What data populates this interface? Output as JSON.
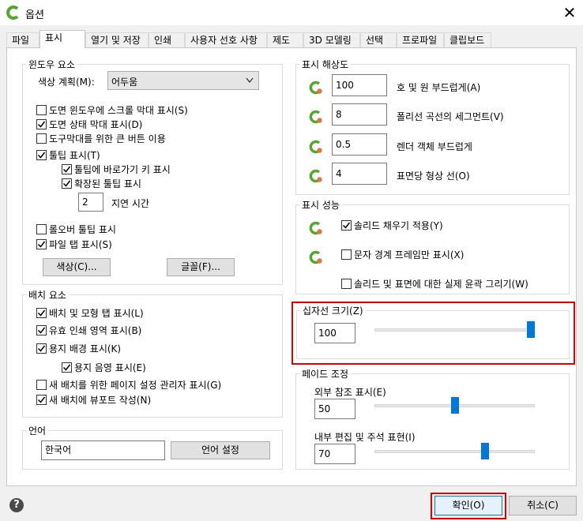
{
  "window": {
    "title": "옵션",
    "close_glyph": "✕"
  },
  "tabs": [
    {
      "label": "파일"
    },
    {
      "label": "표시"
    },
    {
      "label": "열기 및 저장"
    },
    {
      "label": "인쇄"
    },
    {
      "label": "사용자 선호 사항"
    },
    {
      "label": "제도"
    },
    {
      "label": "3D 모델링"
    },
    {
      "label": "선택"
    },
    {
      "label": "프로파일"
    },
    {
      "label": "클립보드"
    }
  ],
  "active_tab": "표시",
  "window_elements": {
    "title": "윈도우 요소",
    "color_scheme_label": "색상 계획(M):",
    "color_scheme_value": "어두움",
    "checkboxes": [
      {
        "label": "도면 윈도우에 스크롤 막대 표시(S)",
        "checked": false
      },
      {
        "label": "도면 상태 막대 표시(D)",
        "checked": true
      },
      {
        "label": "도구막대를 위한 큰 버튼 이용",
        "checked": false
      },
      {
        "label": "툴팁 표시(T)",
        "checked": true
      },
      {
        "label": "툴팁에 바로가기 키 표시",
        "checked": true
      },
      {
        "label": "확장된 툴팁 표시",
        "checked": true
      },
      {
        "label": "롤오버 툴팁 표시",
        "checked": false
      },
      {
        "label": "파일 탭 표시(S)",
        "checked": true
      }
    ],
    "delay_value": "2",
    "delay_label": "지연 시간",
    "colors_button": "색상(C)...",
    "fonts_button": "글꼴(F)..."
  },
  "layout_elements": {
    "title": "배치 요소",
    "checkboxes": [
      {
        "label": "배치 및 모형 탭 표시(L)",
        "checked": true
      },
      {
        "label": "유효 인쇄 영역 표시(B)",
        "checked": true
      },
      {
        "label": "용지 배경 표시(K)",
        "checked": true
      },
      {
        "label": "용지 음영 표시(E)",
        "checked": true
      },
      {
        "label": "새 배치를 위한 페이지 설정 관리자 표시(G)",
        "checked": false
      },
      {
        "label": "새 배치에 뷰포트 작성(N)",
        "checked": true
      }
    ]
  },
  "language": {
    "title": "언어",
    "value": "한국어",
    "button": "언어 설정"
  },
  "display_resolution": {
    "title": "표시 해상도",
    "rows": [
      {
        "value": "100",
        "label": "호 및 원 부드럽게(A)"
      },
      {
        "value": "8",
        "label": "폴리선 곡선의 세그먼트(V)"
      },
      {
        "value": "0.5",
        "label": "렌더 객체 부드럽게"
      },
      {
        "value": "4",
        "label": "표면당 형상 선(O)"
      }
    ]
  },
  "display_performance": {
    "title": "표시 성능",
    "checkboxes": [
      {
        "label": "솔리드 채우기 적용(Y)",
        "checked": true
      },
      {
        "label": "문자 경계 프레임만 표시(X)",
        "checked": false
      },
      {
        "label": "솔리드 및 표면에 대한 실제 윤곽 그리기(W)",
        "checked": false
      }
    ]
  },
  "crosshair": {
    "title": "십자선 크기(Z)",
    "value": "100",
    "level": 100
  },
  "fade_control": {
    "title": "페이드 조정",
    "xref_label": "외부 참조 표시(E)",
    "xref_value": "50",
    "xref_level": 50,
    "inplace_label": "내부 편집 및 주석 표현(I)",
    "inplace_value": "70",
    "inplace_level": 70
  },
  "footer": {
    "help_glyph": "?",
    "ok": "확인(O)",
    "cancel": "취소(C)"
  },
  "colors": {
    "accent": "#0078d7",
    "highlight": "#e00000",
    "brand": "#55a630"
  }
}
